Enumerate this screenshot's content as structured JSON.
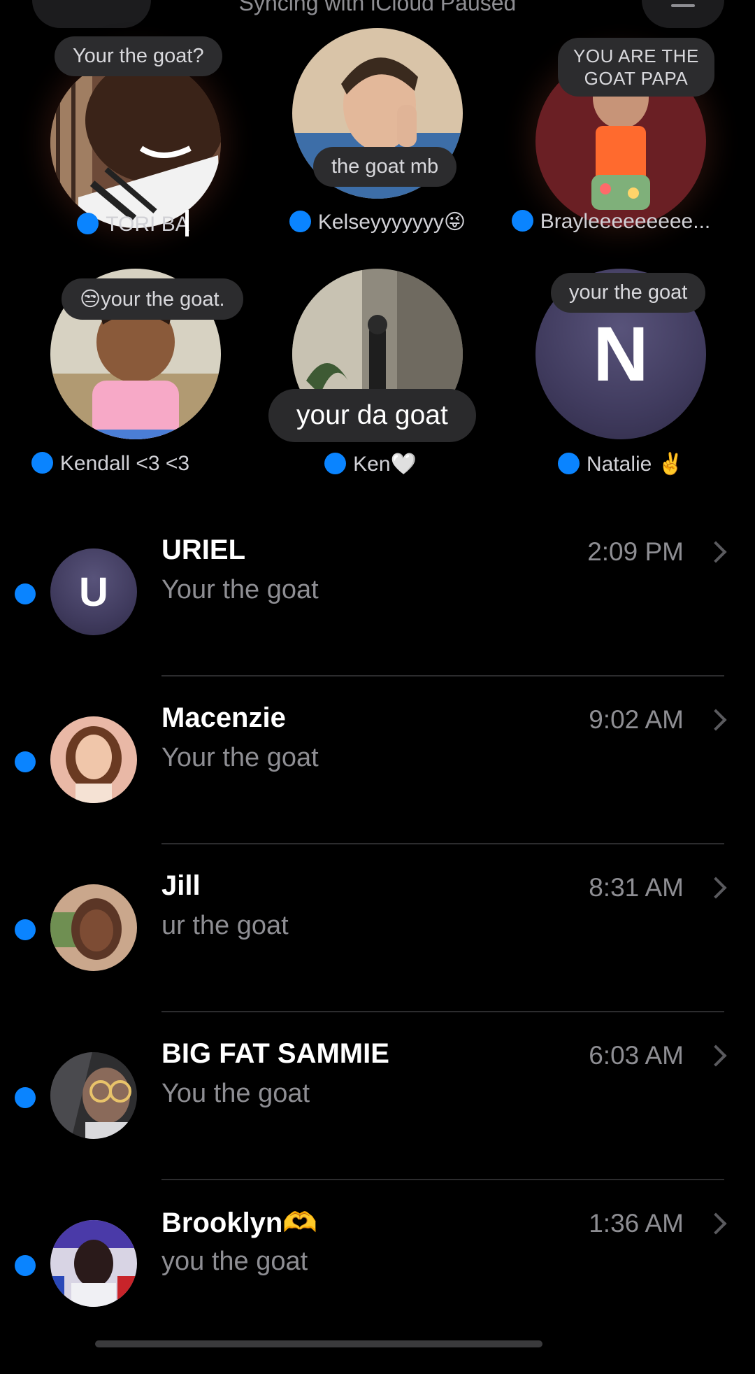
{
  "header": {
    "status": "Syncing with iCloud Paused"
  },
  "pinned": [
    {
      "name": "TORI BAE",
      "name_shown": "TORI BA",
      "bubble": "Your the goat?",
      "avatar": "photo-person-laughing"
    },
    {
      "name": "Kelseyyyyyyy😜",
      "bubble": "the goat mb",
      "avatar": "photo-man"
    },
    {
      "name": "Brayleeeeeeeee...",
      "bubble": "YOU ARE THE GOAT PAPA",
      "bubble_line1": "YOU ARE THE",
      "bubble_line2": "GOAT PAPA",
      "avatar": "photo-child-orange-shirt"
    },
    {
      "name": "Kendall <3 <3",
      "bubble": "😒your the goat.",
      "avatar": "photo-child-pink"
    },
    {
      "name": "Ken🤍",
      "bubble": "your da goat",
      "avatar": "photo-hallway"
    },
    {
      "name": "Natalie ✌️",
      "bubble": "your the goat",
      "avatar_letter": "N"
    }
  ],
  "conversations": [
    {
      "name": "URIEL",
      "message": "Your the goat",
      "time": "2:09 PM",
      "avatar_letter": "U",
      "unread": true
    },
    {
      "name": "Macenzie",
      "message": "Your the goat",
      "time": "9:02 AM",
      "avatar": "photo",
      "unread": true
    },
    {
      "name": "Jill",
      "message": "ur the goat",
      "time": "8:31 AM",
      "avatar": "photo",
      "unread": true
    },
    {
      "name": "BIG FAT SAMMIE",
      "message": "You the goat",
      "time": "6:03 AM",
      "avatar": "photo",
      "unread": true
    },
    {
      "name": "Brooklyn🫶",
      "message": "you the goat",
      "time": "1:36 AM",
      "avatar": "photo",
      "unread": true
    }
  ],
  "colors": {
    "unread_dot": "#0a84ff",
    "background": "#000000",
    "bubble": "#2c2c2e"
  }
}
